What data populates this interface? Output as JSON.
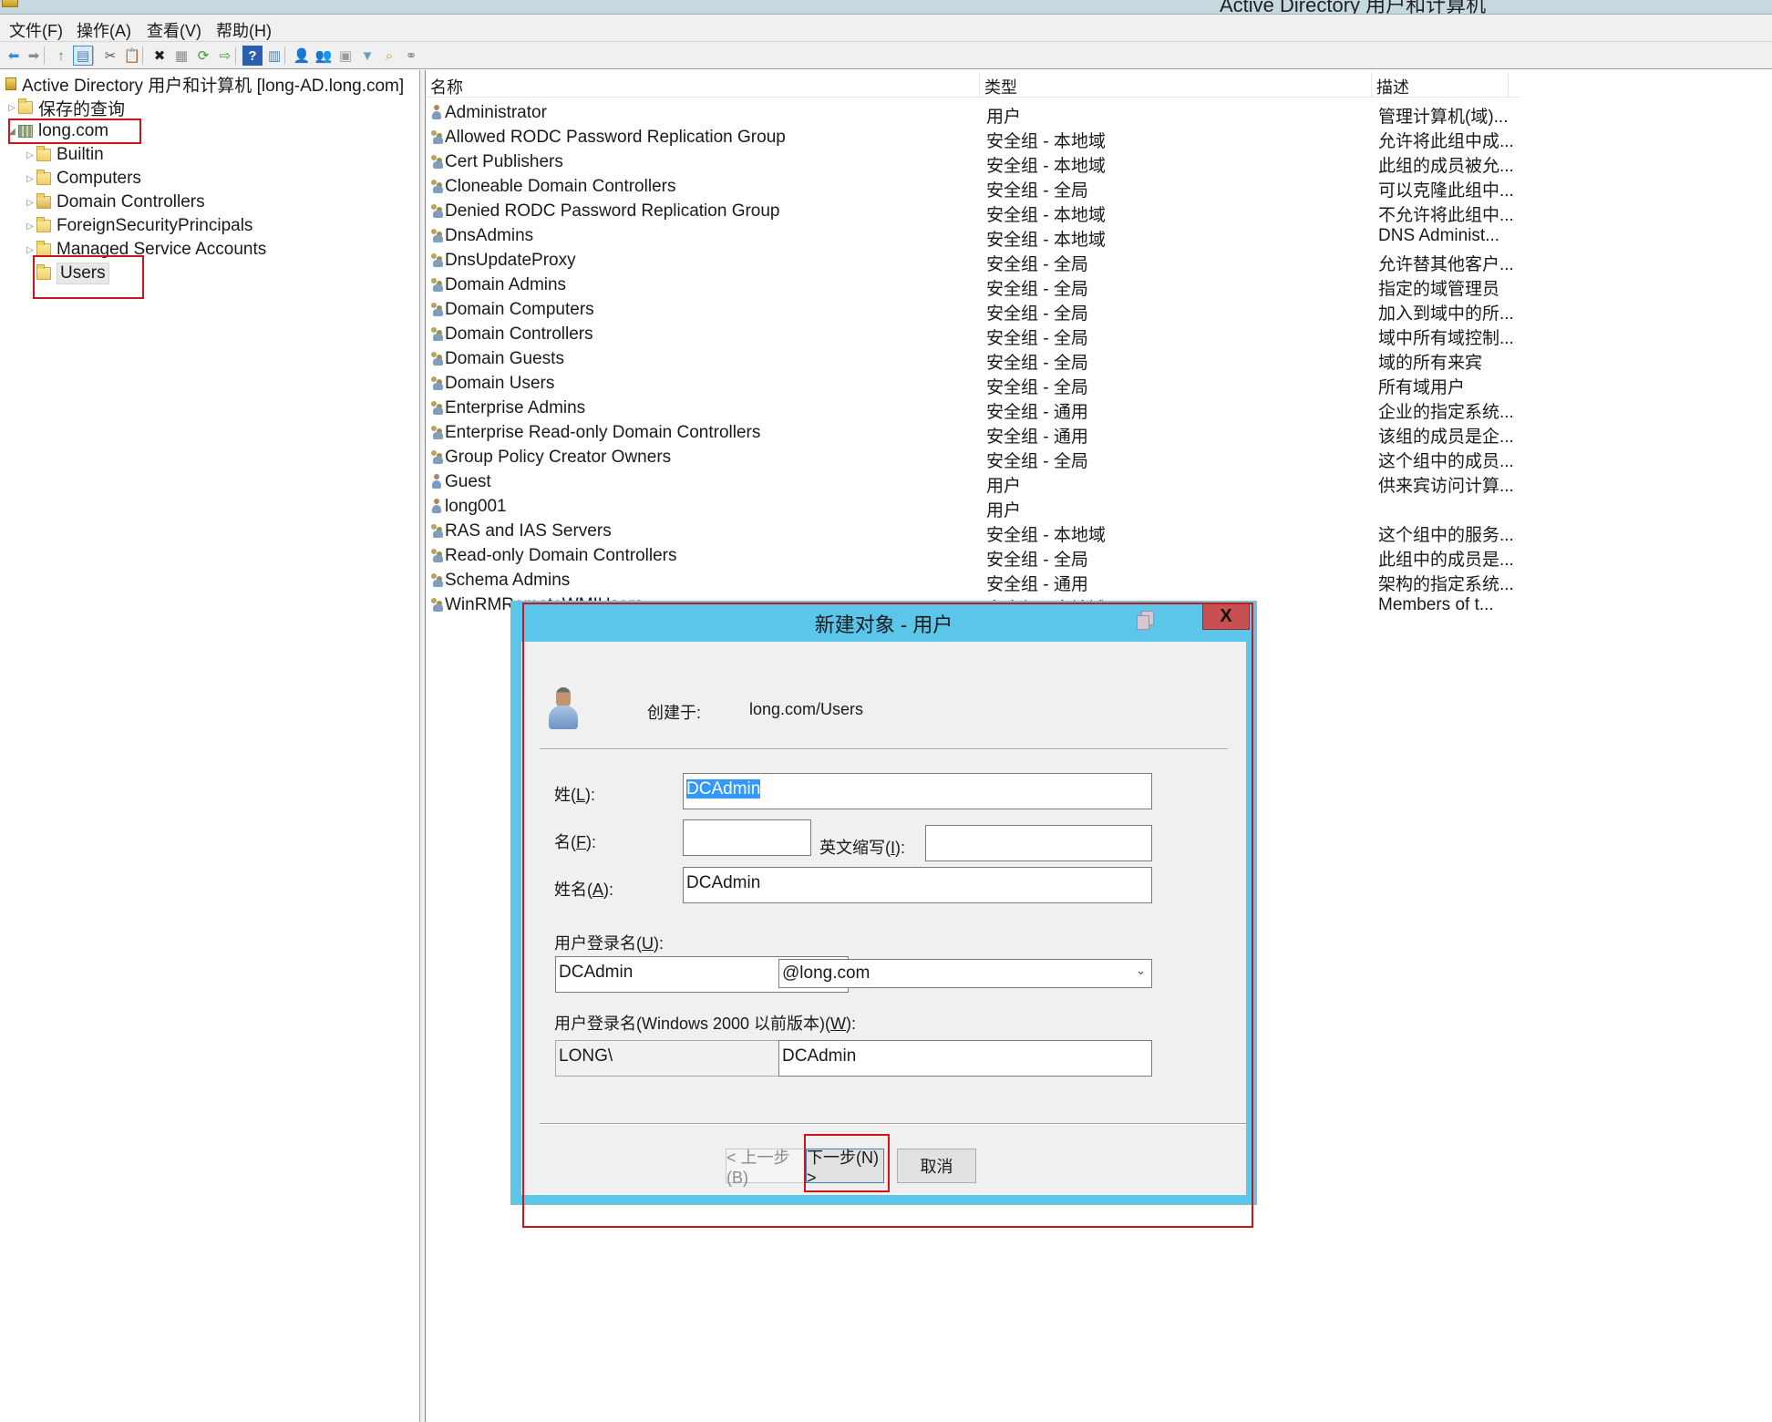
{
  "window": {
    "title": "Active Directory 用户和计算机"
  },
  "menu": [
    {
      "label": "文件(F)"
    },
    {
      "label": "操作(A)"
    },
    {
      "label": "查看(V)"
    },
    {
      "label": "帮助(H)"
    }
  ],
  "toolbar": [
    {
      "name": "back",
      "glyph": "⬅",
      "color": "#2f8fd8"
    },
    {
      "name": "forward",
      "glyph": "➡",
      "color": "#8a8a8a"
    },
    {
      "name": "up-folder",
      "glyph": "↑",
      "color": "#3e9c2c"
    },
    {
      "name": "show-hide-console-tree",
      "glyph": "▤",
      "color": "#4a7fb0"
    },
    {
      "name": "cut",
      "glyph": "✂",
      "color": "#555555"
    },
    {
      "name": "paste",
      "glyph": "📋",
      "color": "#8a6a3a"
    },
    {
      "name": "delete",
      "glyph": "✖",
      "color": "#222222"
    },
    {
      "name": "properties",
      "glyph": "▦",
      "color": "#8a8a8a"
    },
    {
      "name": "refresh",
      "glyph": "⟳",
      "color": "#3e9c2c"
    },
    {
      "name": "export-list",
      "glyph": "⇨",
      "color": "#3e9c2c"
    },
    {
      "name": "help",
      "glyph": "?",
      "color": "#ffffff"
    },
    {
      "name": "show-action-pane",
      "glyph": "▥",
      "color": "#4a7fb0"
    },
    {
      "name": "new-user",
      "glyph": "👤",
      "color": "#c07a30"
    },
    {
      "name": "new-group",
      "glyph": "👥",
      "color": "#a08a30"
    },
    {
      "name": "new-ou",
      "glyph": "▣",
      "color": "#9a9a9a"
    },
    {
      "name": "filter",
      "glyph": "▼",
      "color": "#6aa0c0"
    },
    {
      "name": "find",
      "glyph": "⌕",
      "color": "#c9a030"
    },
    {
      "name": "add-to-group",
      "glyph": "⚭",
      "color": "#7a8a9a"
    }
  ],
  "tree": {
    "root": "Active Directory 用户和计算机 [long-AD.long.com]",
    "items": [
      {
        "label": "保存的查询",
        "icon": "folder",
        "level": 1,
        "expander": "▷"
      },
      {
        "label": "long.com",
        "icon": "domain",
        "level": 1,
        "expander": "◢"
      },
      {
        "label": "Builtin",
        "icon": "folder",
        "level": 2,
        "expander": "▷"
      },
      {
        "label": "Computers",
        "icon": "folder",
        "level": 2,
        "expander": "▷"
      },
      {
        "label": "Domain Controllers",
        "icon": "ou",
        "level": 2,
        "expander": "▷"
      },
      {
        "label": "ForeignSecurityPrincipals",
        "icon": "folder",
        "level": 2,
        "expander": "▷"
      },
      {
        "label": "Managed Service Accounts",
        "icon": "folder",
        "level": 2,
        "expander": "▷"
      },
      {
        "label": "Users",
        "icon": "folder",
        "level": 2,
        "expander": "",
        "selected": true
      }
    ]
  },
  "list": {
    "columns": [
      "名称",
      "类型",
      "描述"
    ],
    "rows": [
      {
        "name": "Administrator",
        "icon": "user",
        "type": "用户",
        "desc": "管理计算机(域)..."
      },
      {
        "name": "Allowed RODC Password Replication Group",
        "icon": "group",
        "type": "安全组 - 本地域",
        "desc": "允许将此组中成..."
      },
      {
        "name": "Cert Publishers",
        "icon": "group",
        "type": "安全组 - 本地域",
        "desc": "此组的成员被允..."
      },
      {
        "name": "Cloneable Domain Controllers",
        "icon": "group",
        "type": "安全组 - 全局",
        "desc": "可以克隆此组中..."
      },
      {
        "name": "Denied RODC Password Replication Group",
        "icon": "group",
        "type": "安全组 - 本地域",
        "desc": "不允许将此组中..."
      },
      {
        "name": "DnsAdmins",
        "icon": "group",
        "type": "安全组 - 本地域",
        "desc": "DNS Administ..."
      },
      {
        "name": "DnsUpdateProxy",
        "icon": "group",
        "type": "安全组 - 全局",
        "desc": "允许替其他客户..."
      },
      {
        "name": "Domain Admins",
        "icon": "group",
        "type": "安全组 - 全局",
        "desc": "指定的域管理员"
      },
      {
        "name": "Domain Computers",
        "icon": "group",
        "type": "安全组 - 全局",
        "desc": "加入到域中的所..."
      },
      {
        "name": "Domain Controllers",
        "icon": "group",
        "type": "安全组 - 全局",
        "desc": "域中所有域控制..."
      },
      {
        "name": "Domain Guests",
        "icon": "group",
        "type": "安全组 - 全局",
        "desc": "域的所有来宾"
      },
      {
        "name": "Domain Users",
        "icon": "group",
        "type": "安全组 - 全局",
        "desc": "所有域用户"
      },
      {
        "name": "Enterprise Admins",
        "icon": "group",
        "type": "安全组 - 通用",
        "desc": "企业的指定系统..."
      },
      {
        "name": "Enterprise Read-only Domain Controllers",
        "icon": "group",
        "type": "安全组 - 通用",
        "desc": "该组的成员是企..."
      },
      {
        "name": "Group Policy Creator Owners",
        "icon": "group",
        "type": "安全组 - 全局",
        "desc": "这个组中的成员..."
      },
      {
        "name": "Guest",
        "icon": "user",
        "type": "用户",
        "desc": "供来宾访问计算..."
      },
      {
        "name": "long001",
        "icon": "user",
        "type": "用户",
        "desc": ""
      },
      {
        "name": "RAS and IAS Servers",
        "icon": "group",
        "type": "安全组 - 本地域",
        "desc": "这个组中的服务..."
      },
      {
        "name": "Read-only Domain Controllers",
        "icon": "group",
        "type": "安全组 - 全局",
        "desc": "此组中的成员是..."
      },
      {
        "name": "Schema Admins",
        "icon": "group",
        "type": "安全组 - 通用",
        "desc": "架构的指定系统..."
      },
      {
        "name": "WinRMRemoteWMIUsers__",
        "icon": "group",
        "type": "安全组 - 本地域",
        "desc": "Members of t..."
      }
    ]
  },
  "dialog": {
    "title": "新建对象 - 用户",
    "close_label": "X",
    "created_in_label": "创建于:",
    "created_in_value": "long.com/Users",
    "last_name_label": "姓(L):",
    "last_name_value": "DCAdmin",
    "first_name_label": "名(F):",
    "first_name_value": "",
    "initials_label": "英文缩写(I):",
    "initials_value": "",
    "full_name_label": "姓名(A):",
    "full_name_value": "DCAdmin",
    "logon_name_label": "用户登录名(U):",
    "logon_name_value": "DCAdmin",
    "upn_suffix_value": "@long.com",
    "pre2000_label": "用户登录名(Windows 2000 以前版本)(W):",
    "pre2000_domain_value": "LONG\\",
    "pre2000_name_value": "DCAdmin",
    "back_label": "< 上一步(B)",
    "next_label": "下一步(N) >",
    "cancel_label": "取消"
  },
  "colors": {
    "dialog_frame": "#5bc6ea",
    "close_button": "#c75050",
    "annotation": "#d0141c",
    "selection": "#3399ff"
  }
}
